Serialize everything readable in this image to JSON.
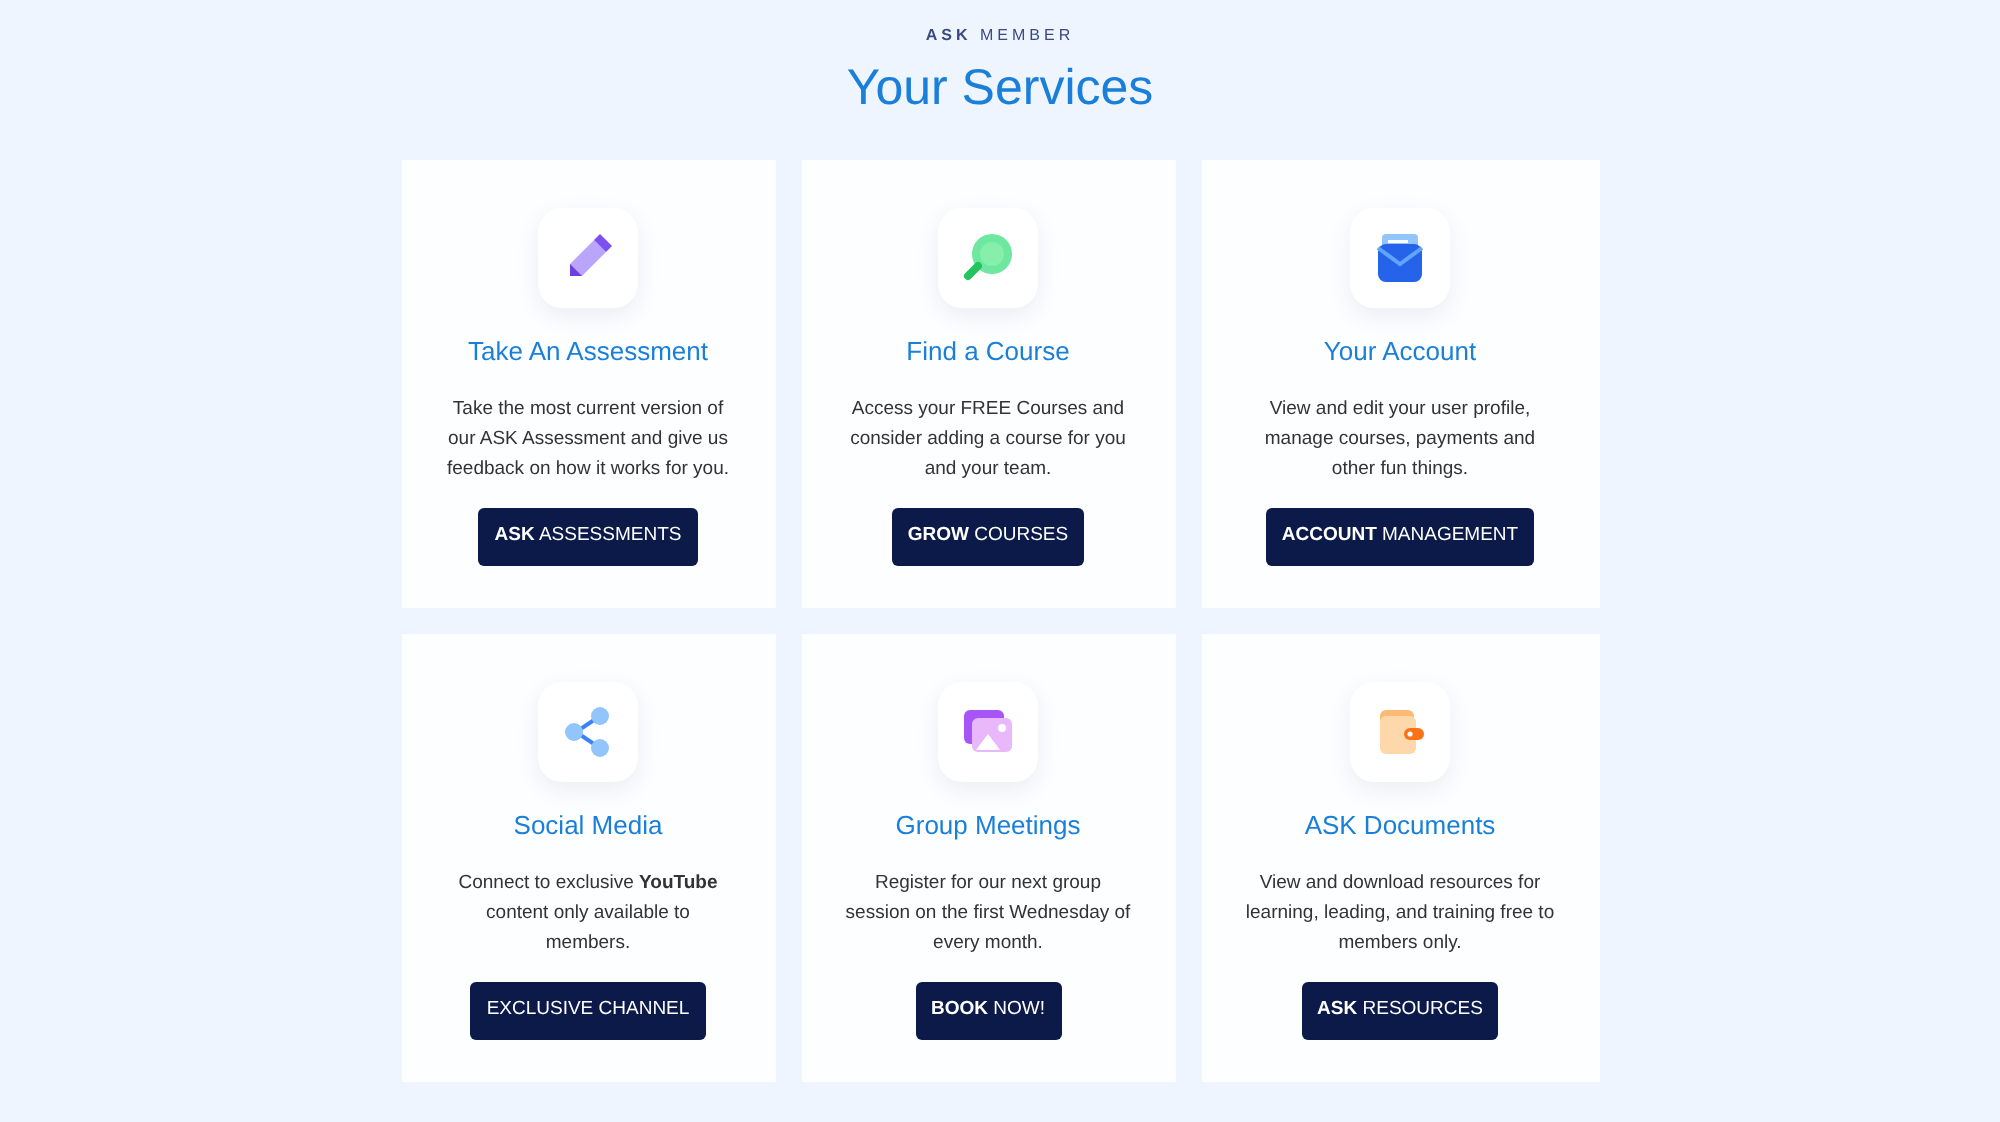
{
  "eyebrow": "**ASK** MEMBER",
  "title": "Your Services",
  "cards": [
    {
      "title": "Take An Assessment",
      "text": "Take the most current version of our ASK Assessment and give us feedback on how it works for you.",
      "button": "**ASK** ASSESSMENTS"
    },
    {
      "title": "Find a Course",
      "text": "Access your FREE Courses and consider adding a course for you and your team.",
      "button": "**GROW** COURSES"
    },
    {
      "title": "Your Account",
      "text": "View and edit your user profile, manage courses, payments and other fun things.",
      "button": "**ACCOUNT** MANAGEMENT"
    },
    {
      "title": "Social Media",
      "text": "Connect to exclusive **YouTube** content only available to members.",
      "button": "EXCLUSIVE CHANNEL"
    },
    {
      "title": "Group Meetings",
      "text": "Register for our next group session on the first Wednesday of every month.",
      "button": "**BOOK** NOW!"
    },
    {
      "title": "ASK Documents",
      "text": "View and download resources for learning, leading, and training free to members only.",
      "button": "**ASK** RESOURCES"
    }
  ]
}
